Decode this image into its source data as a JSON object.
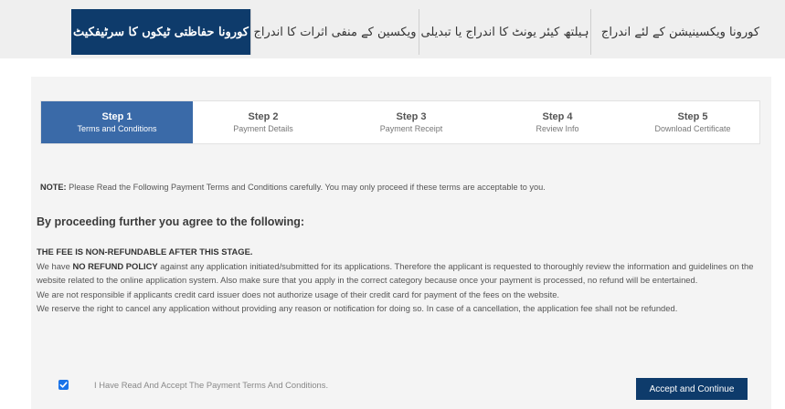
{
  "topbar": {
    "tabs": [
      {
        "label": "کورونا ویکسینیشن کے لئے اندراج"
      },
      {
        "label": "ہیلتھ کیئر یونٹ کا اندراج یا تبدیلی"
      },
      {
        "label": "ویکسین کے منفی اثرات کا اندراج"
      },
      {
        "label": "کورونا حفاظتی ٹیکوں کا سرٹیفکیٹ"
      }
    ]
  },
  "stepper": {
    "steps": [
      {
        "title": "Step 1",
        "subtitle": "Terms and Conditions"
      },
      {
        "title": "Step 2",
        "subtitle": "Payment Details"
      },
      {
        "title": "Step 3",
        "subtitle": "Payment Receipt"
      },
      {
        "title": "Step 4",
        "subtitle": "Review Info"
      },
      {
        "title": "Step 5",
        "subtitle": "Download Certificate"
      }
    ]
  },
  "note": {
    "label": "NOTE:",
    "text": " Please Read the Following Payment Terms and Conditions carefully. You may only proceed if these terms are acceptable to you."
  },
  "agree_title": "By proceeding further you agree to the following:",
  "terms": {
    "header": "THE FEE IS NON-REFUNDABLE AFTER THIS STAGE.",
    "p1_pre": "We have ",
    "p1_bold": "NO REFUND POLICY",
    "p1_post": " against any application initiated/submitted for its applications. Therefore the applicant is requested to thoroughly review the information and guidelines on the website related to the online application system. Also make sure that you apply in the correct category because once your payment is processed, no refund will be entertained.",
    "p2": "We are not responsible if applicants credit card issuer does not authorize usage of their credit card for payment of the fees on the website.",
    "p3": "We reserve the right to cancel any application without providing any reason or notification for doing so. In case of a cancellation, the application fee shall not be refunded."
  },
  "checkbox": {
    "label": "I Have Read And Accept The Payment Terms And Conditions.",
    "checked": true
  },
  "accept_button": "Accept and Continue",
  "colors": {
    "navy": "#0e3b6b",
    "step_active": "#3a6aa8",
    "checkbox": "#1a73e8"
  }
}
